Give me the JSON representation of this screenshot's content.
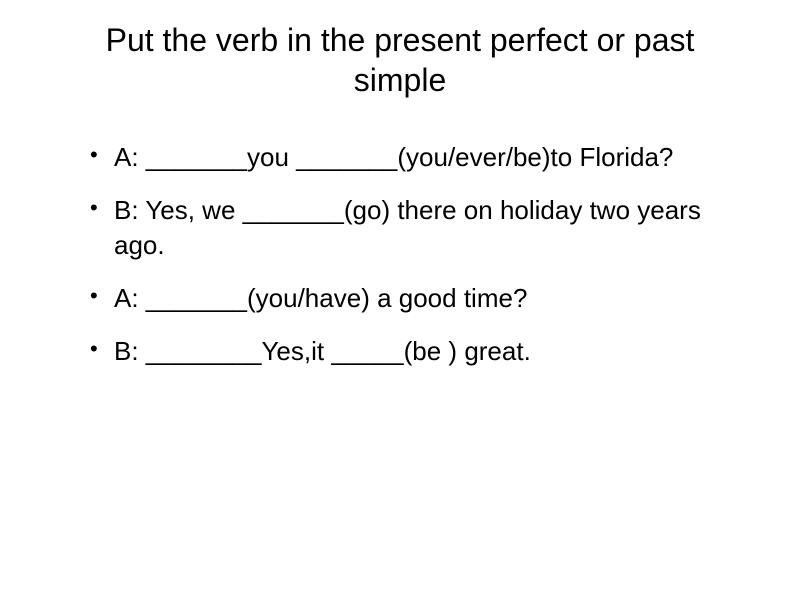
{
  "title": "Put the verb in the present perfect or past simple",
  "items": [
    "A: _______you _______(you/ever/be)to Florida?",
    "B: Yes, we _______(go) there on holiday two years ago.",
    "A: _______(you/have) a good time?",
    "B: ________Yes,it _____(be ) great."
  ]
}
